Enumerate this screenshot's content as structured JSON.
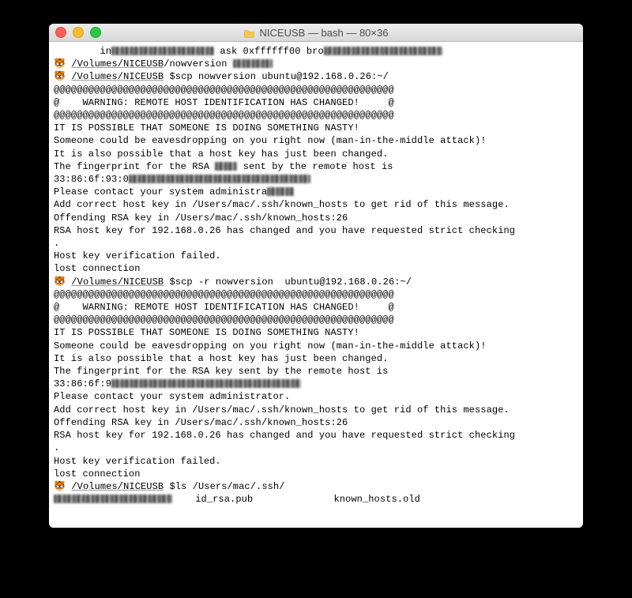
{
  "window": {
    "title": "NICEUSB — bash — 80×36",
    "buttons": {
      "close": "close",
      "minimize": "minimize",
      "zoom": "zoom"
    }
  },
  "prompt": {
    "emoji": "🐯",
    "path": "/Volumes/NICEUSB",
    "suffix": " $"
  },
  "lines": {
    "l0_pre": "        in",
    "l0_mid": "ask 0xffffff00 bro",
    "nowversion": "/nowversion",
    "cmd1": "scp nowversion ubuntu@192.168.0.26:~/",
    "at1": "@@@@@@@@@@@@@@@@@@@@@@@@@@@@@@@@@@@@@@@@@@@@@@@@@@@@@@@@@@@",
    "at2": "@    WARNING: REMOTE HOST IDENTIFICATION HAS CHANGED!     @",
    "at3": "@@@@@@@@@@@@@@@@@@@@@@@@@@@@@@@@@@@@@@@@@@@@@@@@@@@@@@@@@@@",
    "nasty": "IT IS POSSIBLE THAT SOMEONE IS DOING SOMETHING NASTY!",
    "eaves": "Someone could be eavesdropping on you right now (man-in-the-middle attack)!",
    "also": "It is also possible that a host key has just been changed.",
    "fp1a": "The fingerprint for the RSA ",
    "fp1b": " sent by the remote host is",
    "fp2": "The fingerprint for the RSA key sent by the remote host is",
    "fpval_prefix1": "33:86:6f:93:0",
    "fpval_prefix2": "33:86:6f:9",
    "please1": "Please contact your system administra",
    "please2": "Please contact your system administrator.",
    "addkey": "Add correct host key in /Users/mac/.ssh/known_hosts to get rid of this message.",
    "offend": "Offending RSA key in /Users/mac/.ssh/known_hosts:26",
    "strict": "RSA host key for 192.168.0.26 has changed and you have requested strict checking",
    "dot": ".",
    "verif": "Host key verification failed.",
    "lost": "lost connection",
    "cmd2": "scp -r nowversion  ubuntu@192.168.0.26:~/",
    "cmd3": "ls /Users/mac/.ssh/",
    "ls_mid": "id_rsa.pub",
    "ls_right": "known_hosts.old"
  }
}
